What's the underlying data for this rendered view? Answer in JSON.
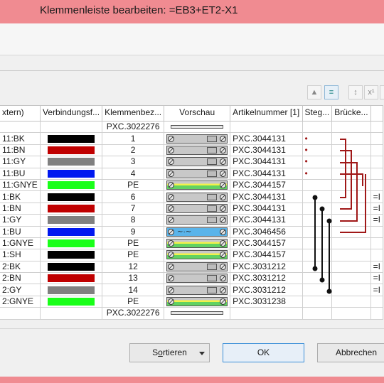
{
  "window": {
    "title": "Klemmenleiste bearbeiten: =EB3+ET2-X1"
  },
  "toolbar": {
    "buttons": [
      {
        "name": "move-up-button",
        "glyph": "▲"
      },
      {
        "name": "align-button",
        "glyph": "≡"
      },
      {
        "name": "sort-vertical-button",
        "glyph": "↕"
      },
      {
        "name": "multiply-button",
        "glyph": "x¹"
      },
      {
        "name": "expand-button",
        "glyph": "↕"
      }
    ]
  },
  "table": {
    "columns": [
      "xtern)",
      "Verbindungsf...",
      "Klemmenbez...",
      "Vorschau",
      "Artikelnummer [1]",
      "Steg...",
      "Brücke...",
      ""
    ],
    "rows": [
      {
        "col1": "",
        "color": null,
        "term": "PXC.3022276",
        "preview": "bar",
        "article": "",
        "marker": "",
        "bruecke": "",
        "extra": ""
      },
      {
        "col1": "11:BK",
        "color": "#000000",
        "term": "1",
        "preview": "gray",
        "article": "PXC.3044131",
        "marker": "•",
        "bruecke": "",
        "extra": ""
      },
      {
        "col1": "11:BN",
        "color": "#c00000",
        "term": "2",
        "preview": "gray",
        "article": "PXC.3044131",
        "marker": "•",
        "bruecke": "",
        "extra": ""
      },
      {
        "col1": "11:GY",
        "color": "#808080",
        "term": "3",
        "preview": "gray",
        "article": "PXC.3044131",
        "marker": "•",
        "bruecke": "",
        "extra": ""
      },
      {
        "col1": "11:BU",
        "color": "#0018f0",
        "term": "4",
        "preview": "gray",
        "article": "PXC.3044131",
        "marker": "•",
        "bruecke": "",
        "extra": ""
      },
      {
        "col1": "11:GNYE",
        "color": "#19ff19",
        "term": "PE",
        "preview": "pe",
        "article": "PXC.3044157",
        "marker": "",
        "bruecke": "",
        "extra": ""
      },
      {
        "col1": "1:BK",
        "color": "#000000",
        "term": "6",
        "preview": "gray",
        "article": "PXC.3044131",
        "marker": "",
        "bruecke": "",
        "extra": "=I"
      },
      {
        "col1": "1:BN",
        "color": "#c00000",
        "term": "7",
        "preview": "gray",
        "article": "PXC.3044131",
        "marker": "",
        "bruecke": "",
        "extra": "=I"
      },
      {
        "col1": "1:GY",
        "color": "#808080",
        "term": "8",
        "preview": "gray",
        "article": "PXC.3044131",
        "marker": "",
        "bruecke": "",
        "extra": "=I"
      },
      {
        "col1": "1:BU",
        "color": "#0018f0",
        "term": "9",
        "preview": "blue",
        "article": "PXC.3046456",
        "marker": "",
        "bruecke": "",
        "extra": ""
      },
      {
        "col1": "1:GNYE",
        "color": "#19ff19",
        "term": "PE",
        "preview": "pe",
        "article": "PXC.3044157",
        "marker": "",
        "bruecke": "",
        "extra": ""
      },
      {
        "col1": "1:SH",
        "color": "#000000",
        "term": "PE",
        "preview": "pe",
        "article": "PXC.3044157",
        "marker": "",
        "bruecke": "",
        "extra": ""
      },
      {
        "col1": "2:BK",
        "color": "#000000",
        "term": "12",
        "preview": "gray",
        "article": "PXC.3031212",
        "marker": "",
        "bruecke": "",
        "extra": "=I"
      },
      {
        "col1": "2:BN",
        "color": "#c00000",
        "term": "13",
        "preview": "gray",
        "article": "PXC.3031212",
        "marker": "",
        "bruecke": "",
        "extra": "=I"
      },
      {
        "col1": "2:GY",
        "color": "#808080",
        "term": "14",
        "preview": "gray",
        "article": "PXC.3031212",
        "marker": "",
        "bruecke": "",
        "extra": "=I"
      },
      {
        "col1": "2:GNYE",
        "color": "#19ff19",
        "term": "PE",
        "preview": "pe",
        "article": "PXC.3031238",
        "marker": "",
        "bruecke": "",
        "extra": ""
      },
      {
        "col1": "",
        "color": null,
        "term": "PXC.3022276",
        "preview": "bar",
        "article": "",
        "marker": "",
        "bruecke": "",
        "extra": ""
      }
    ]
  },
  "footer": {
    "sort_label_pre": "S",
    "sort_label_underlined": "o",
    "sort_label_post": "rtieren",
    "ok_label": "OK",
    "cancel_label": "Abbrechen"
  }
}
